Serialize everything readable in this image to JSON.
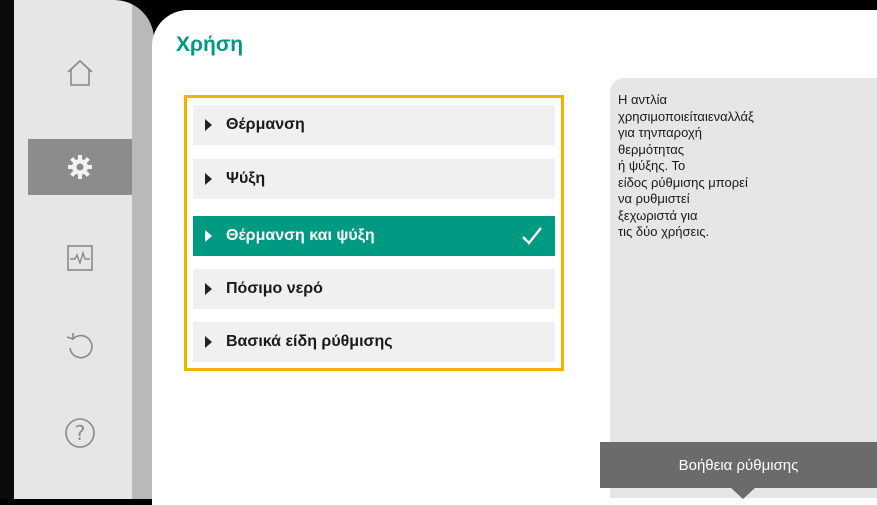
{
  "nav": {
    "items": [
      {
        "name": "home",
        "icon": "home-icon",
        "active": false
      },
      {
        "name": "settings",
        "icon": "gear-icon",
        "active": true
      },
      {
        "name": "diagnostics",
        "icon": "pulse-monitor-icon",
        "active": false
      },
      {
        "name": "restore",
        "icon": "undo-icon",
        "active": false
      },
      {
        "name": "help",
        "icon": "question-icon",
        "active": false
      }
    ]
  },
  "page": {
    "title": "Χρήση"
  },
  "menu": {
    "items": [
      {
        "label": "Θέρμανση",
        "selected": false
      },
      {
        "label": "Ψύξη",
        "selected": false
      },
      {
        "label": "Θέρμανση και ψύξη",
        "selected": true
      },
      {
        "label": "Πόσιμο νερό",
        "selected": false
      },
      {
        "label": "Βασικά είδη ρύθμισης",
        "selected": false
      }
    ]
  },
  "help": {
    "text": "Η αντλία\nχρησιμοποιείταιεναλλάξ\nγια τηνπαροχή\nθερμότητας\nή ψύξης. Το\nείδος ρύθμισης μπορεί\nνα ρυθμιστεί\nξεχωριστά για\nτις δύο χρήσεις.",
    "button_label": "Βοήθεια ρύθμισης"
  },
  "colors": {
    "accent": "#009a82",
    "highlight_border": "#f5b100",
    "sidebar_active": "#8c8c8c",
    "help_button": "#6b6b6b"
  }
}
